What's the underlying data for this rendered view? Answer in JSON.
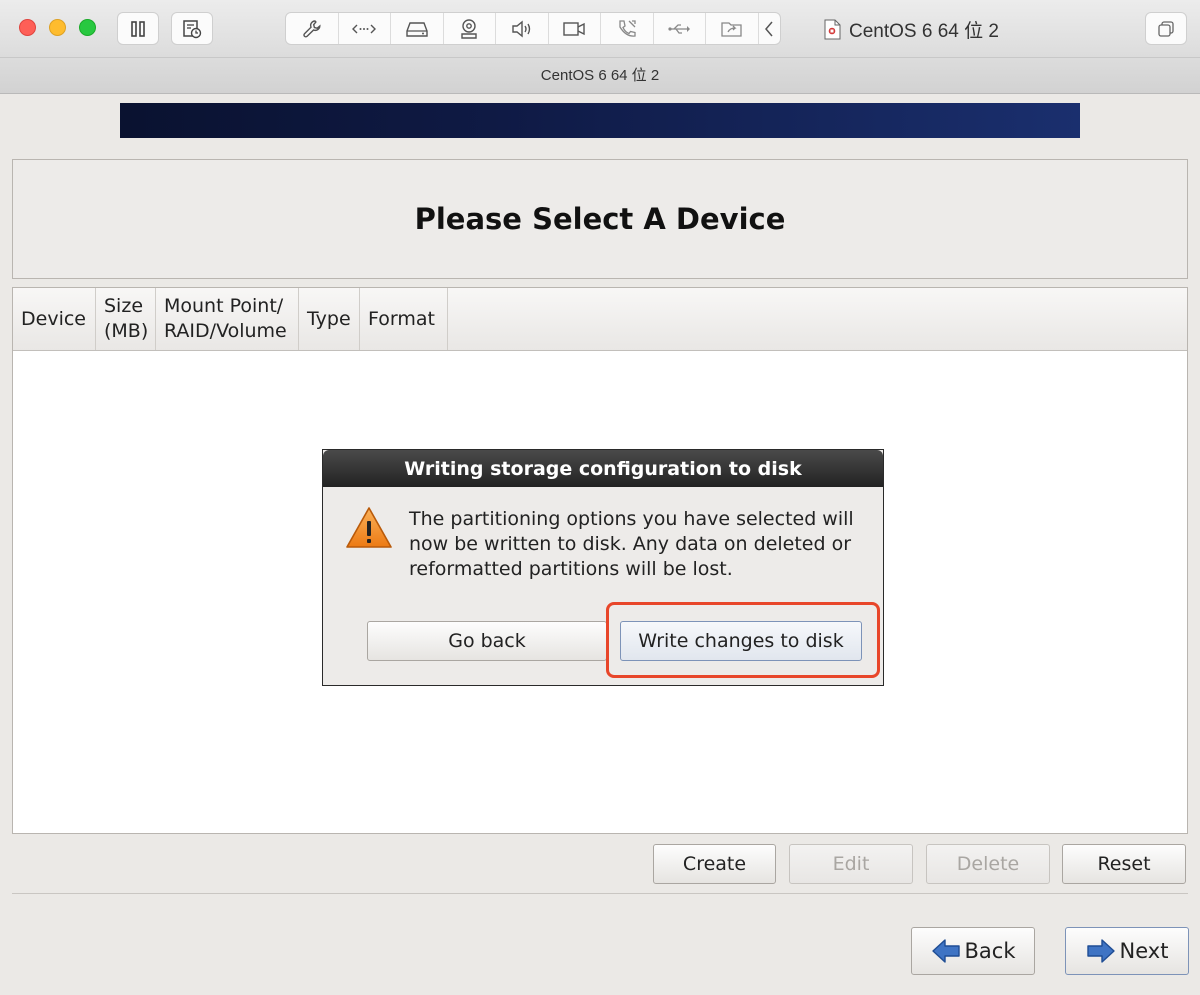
{
  "window": {
    "title": "CentOS 6 64 位 2",
    "vm_tab_label": "CentOS 6 64 位 2"
  },
  "toolbar": {
    "left_icons": [
      "pause-icon",
      "snapshot-icon"
    ],
    "device_icons": [
      "wrench-icon",
      "network-icon",
      "hard-disk-icon",
      "camera-icon",
      "sound-icon",
      "video-camera-icon",
      "phone-icon",
      "usb-icon",
      "shared-folder-icon",
      "chevron-left-icon"
    ],
    "right_icon": "window-copy-icon"
  },
  "installer": {
    "heading": "Please Select A Device",
    "table": {
      "columns": [
        "Device",
        "Size\n(MB)",
        "Mount Point/\nRAID/Volume",
        "Type",
        "Format"
      ]
    },
    "actions": {
      "create": "Create",
      "edit": "Edit",
      "delete": "Delete",
      "reset": "Reset"
    },
    "nav": {
      "back": "Back",
      "next": "Next"
    }
  },
  "dialog": {
    "title": "Writing storage configuration to disk",
    "message": "The partitioning options you have selected will now be written to disk.  Any data on deleted or reformatted partitions will be lost.",
    "go_back": "Go back",
    "write": "Write changes to disk"
  },
  "colors": {
    "highlight": "#e8462a",
    "banner": "#0f1a45"
  }
}
